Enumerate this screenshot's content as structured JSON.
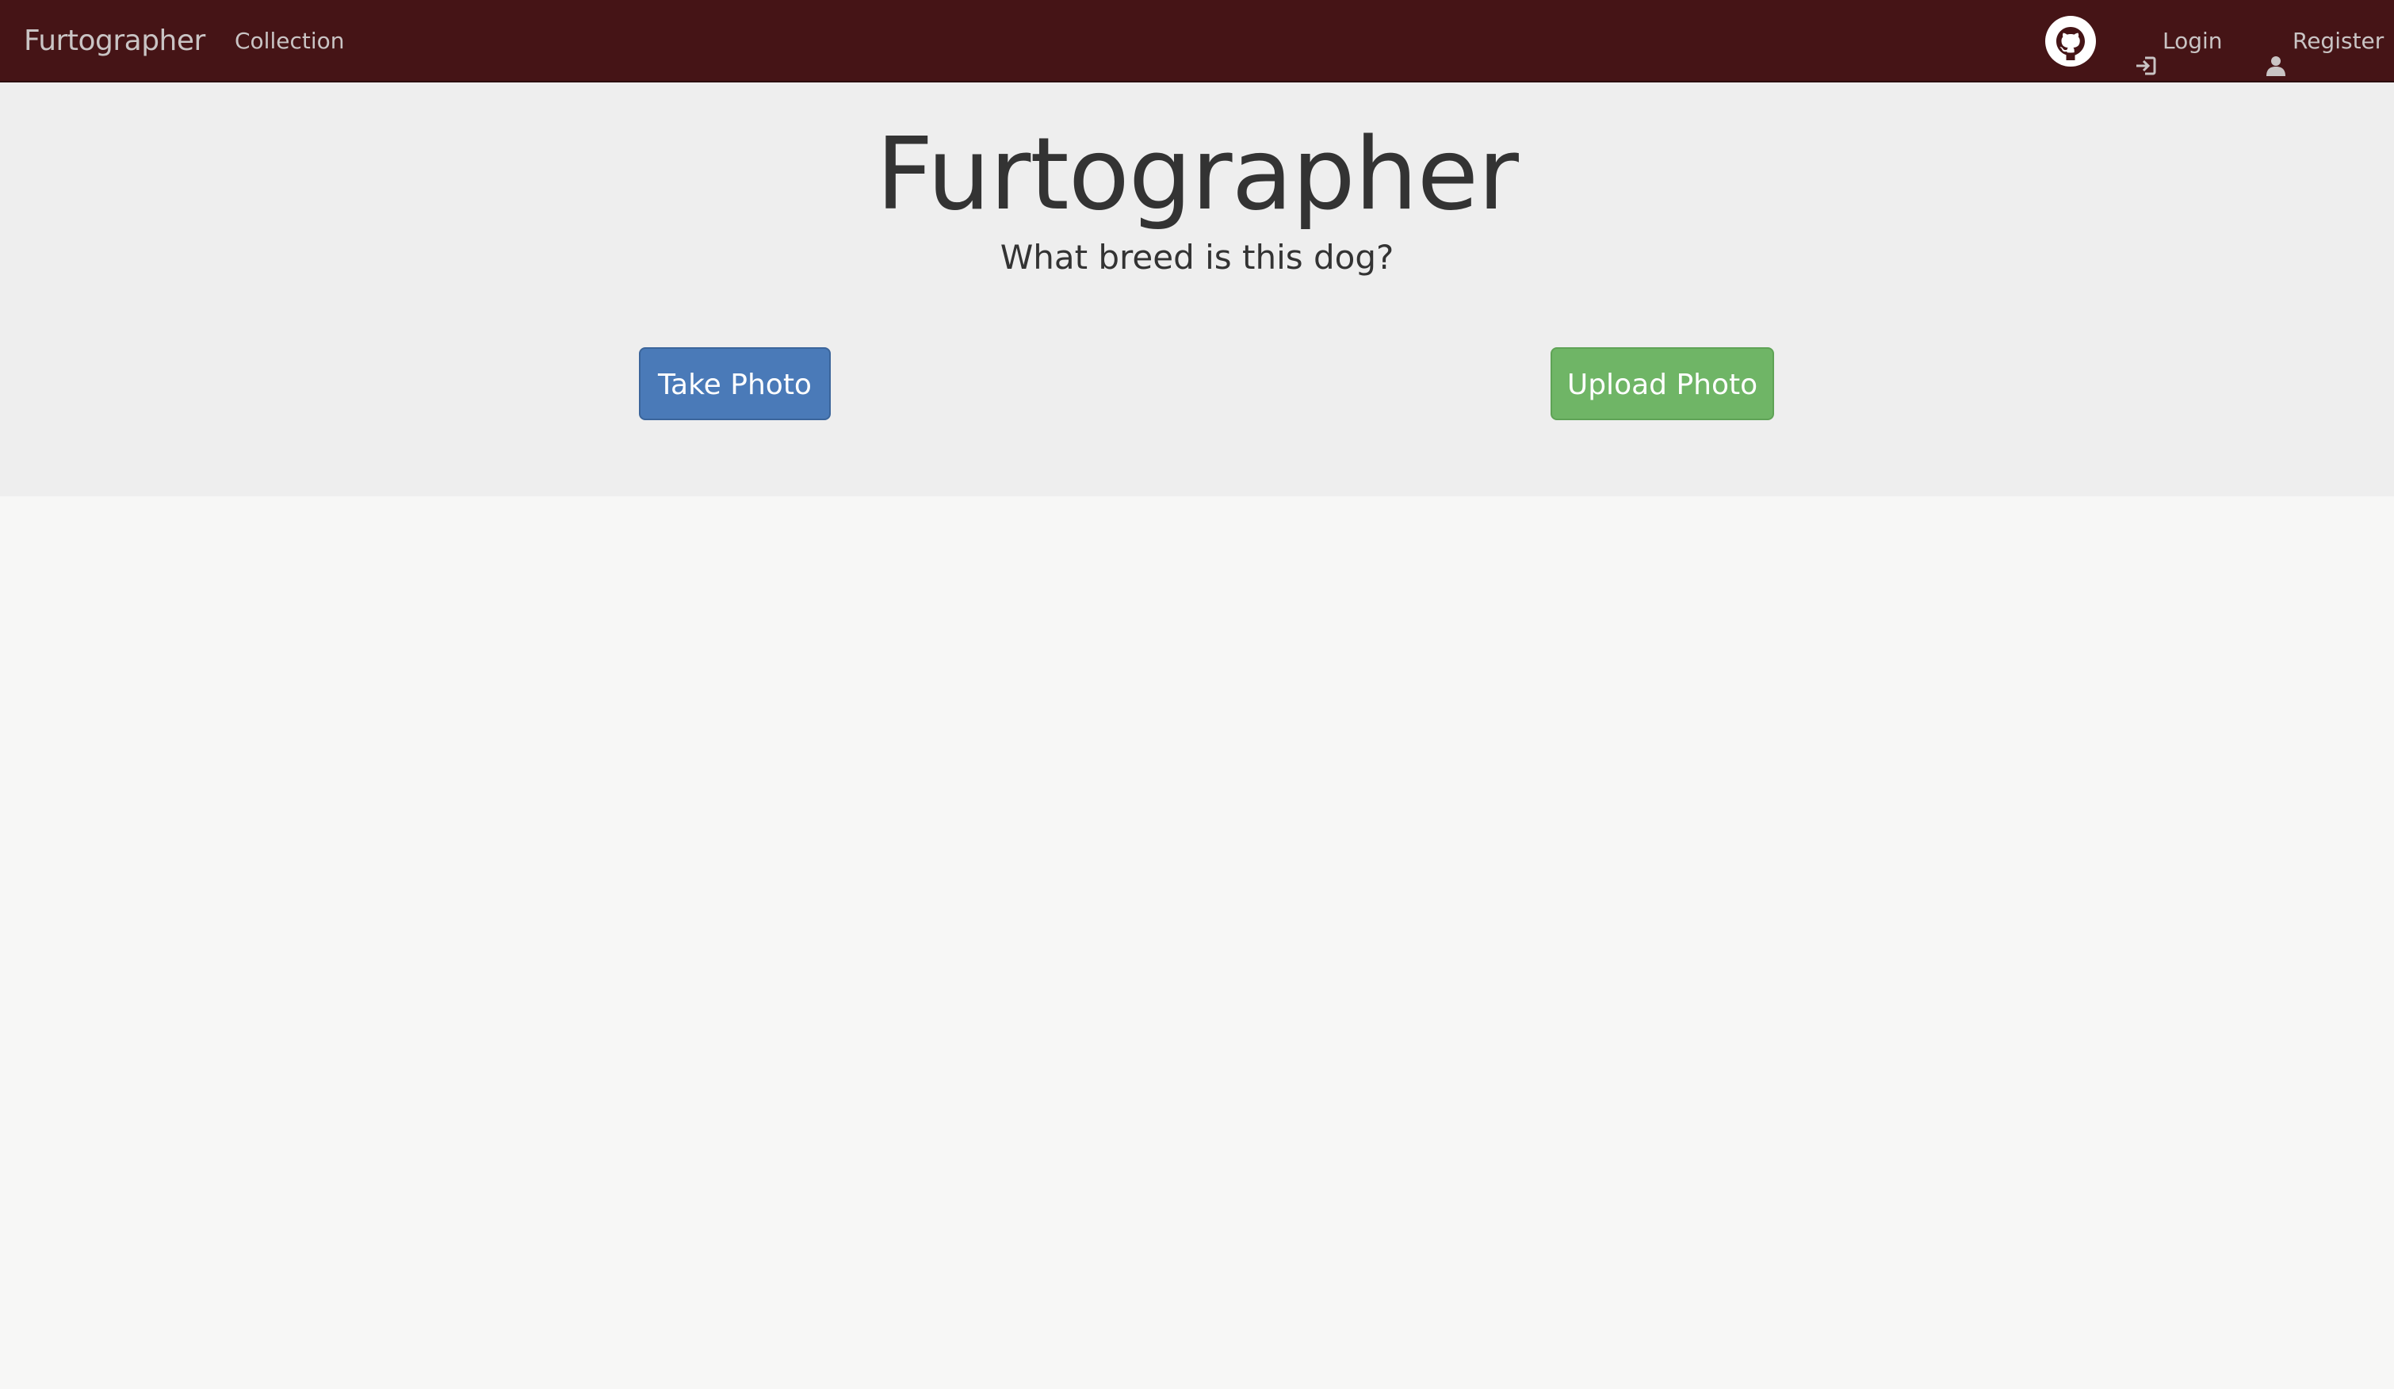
{
  "navbar": {
    "brand": "Furtographer",
    "links": {
      "collection": "Collection"
    },
    "right": {
      "github_icon": "github-icon",
      "login_label": "Login",
      "login_icon": "login-icon",
      "register_label": "Register",
      "register_icon": "user-icon"
    },
    "colors": {
      "background": "#451416",
      "text": "#c9c4c4"
    }
  },
  "hero": {
    "title": "Furtographer",
    "subtitle": "What breed is this dog?",
    "buttons": {
      "take_photo": "Take Photo",
      "upload_photo": "Upload Photo"
    },
    "colors": {
      "background": "#eeeeee",
      "take_photo": "#4a7ab8",
      "upload_photo": "#6fb566"
    }
  }
}
